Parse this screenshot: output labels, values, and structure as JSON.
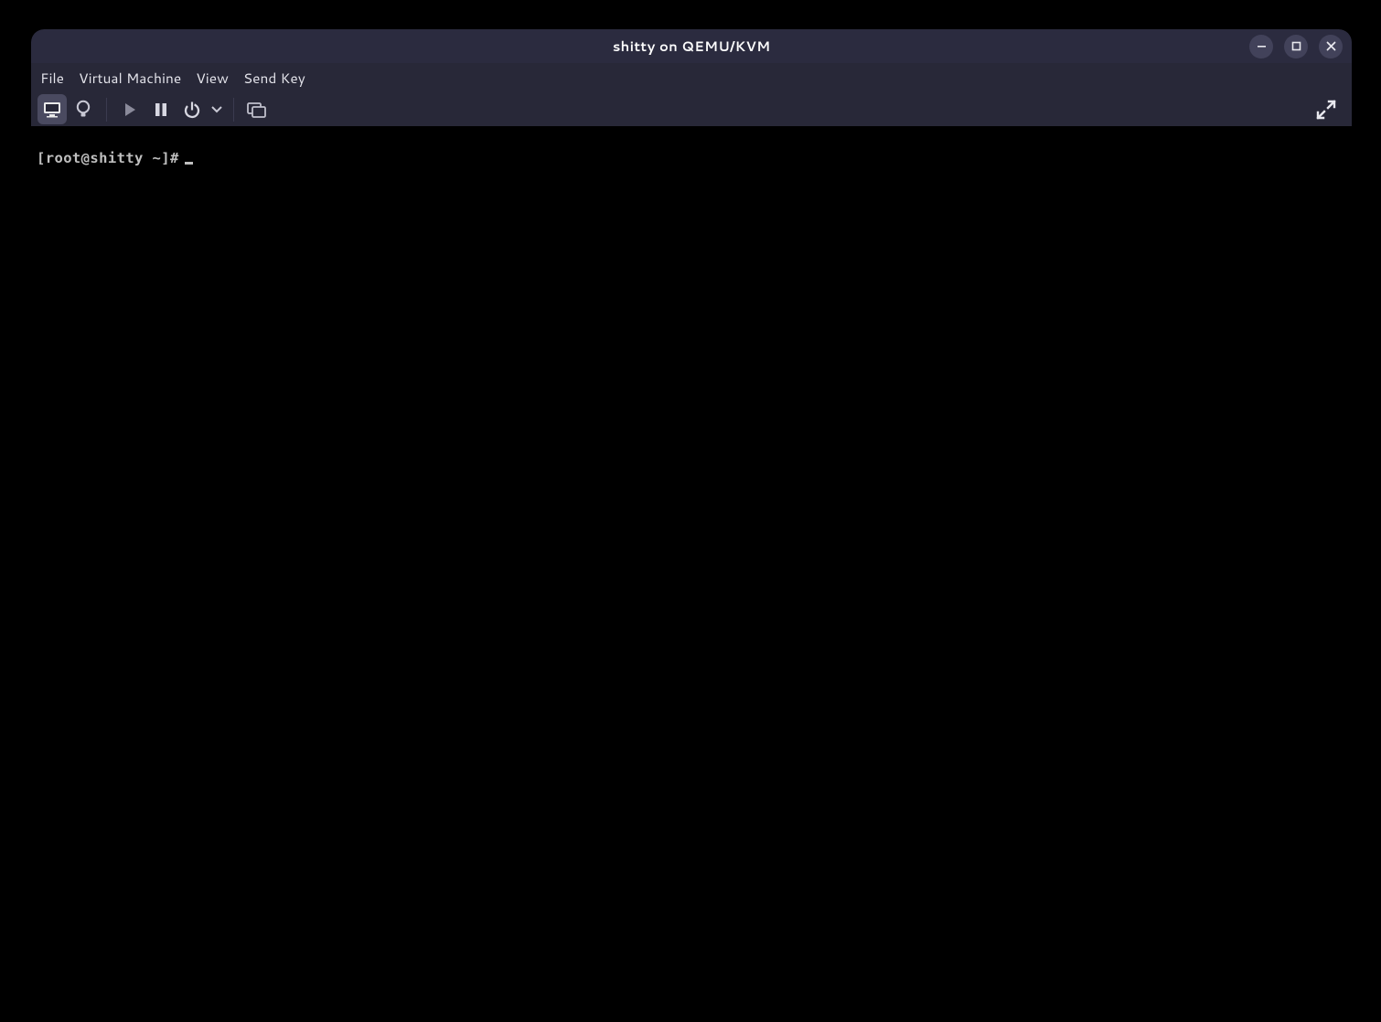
{
  "window": {
    "title": "shitty on QEMU/KVM"
  },
  "menubar": {
    "items": [
      "File",
      "Virtual Machine",
      "View",
      "Send Key"
    ]
  },
  "toolbar": {
    "icons": {
      "console": "console-icon",
      "info": "lightbulb-icon",
      "play": "play-icon",
      "pause": "pause-icon",
      "power": "power-icon",
      "dropdown": "chevron-down-icon",
      "snapshot": "snapshot-icon",
      "fullscreen": "fullscreen-icon"
    }
  },
  "console": {
    "prompt": "[root@shitty ~]#"
  }
}
